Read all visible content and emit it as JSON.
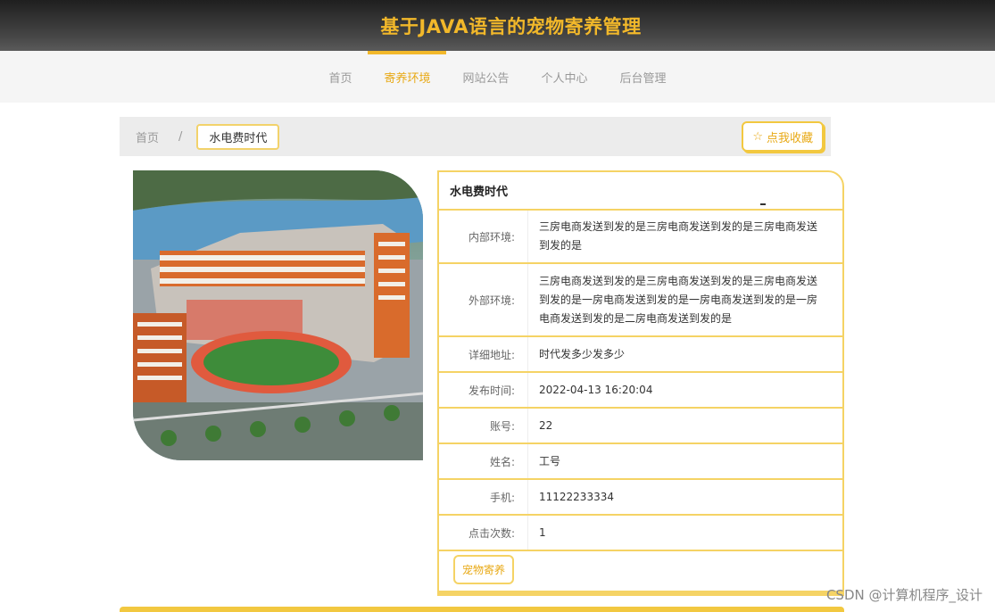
{
  "header": {
    "title": "基于JAVA语言的宠物寄养管理"
  },
  "nav": [
    {
      "label": "首页",
      "active": false
    },
    {
      "label": "寄养环境",
      "active": true
    },
    {
      "label": "网站公告",
      "active": false
    },
    {
      "label": "个人中心",
      "active": false
    },
    {
      "label": "后台管理",
      "active": false
    }
  ],
  "breadcrumb": {
    "home": "首页",
    "separator": "/",
    "current": "水电费时代"
  },
  "favorite": {
    "label": "点我收藏",
    "icon": "star-icon"
  },
  "detail": {
    "title": "水电费时代",
    "rows": [
      {
        "label": "内部环境:",
        "value": "三房电商发送到发的是三房电商发送到发的是三房电商发送到发的是"
      },
      {
        "label": "外部环境:",
        "value": "三房电商发送到发的是三房电商发送到发的是三房电商发送到发的是一房电商发送到发的是一房电商发送到发的是一房电商发送到发的是二房电商发送到发的是"
      },
      {
        "label": "详细地址:",
        "value": "时代发多少发多少"
      },
      {
        "label": "发布时间:",
        "value": "2022-04-13 16:20:04"
      },
      {
        "label": "账号:",
        "value": "22"
      },
      {
        "label": "姓名:",
        "value": "工号"
      },
      {
        "label": "手机:",
        "value": "11122233334"
      },
      {
        "label": "点击次数:",
        "value": "1"
      }
    ],
    "action_label": "宠物寄养"
  },
  "watermark": "CSDN @计算机程序_设计",
  "colors": {
    "accent": "#f2b82a",
    "border": "#f5d365",
    "header_bg": "#2e2e2e"
  }
}
